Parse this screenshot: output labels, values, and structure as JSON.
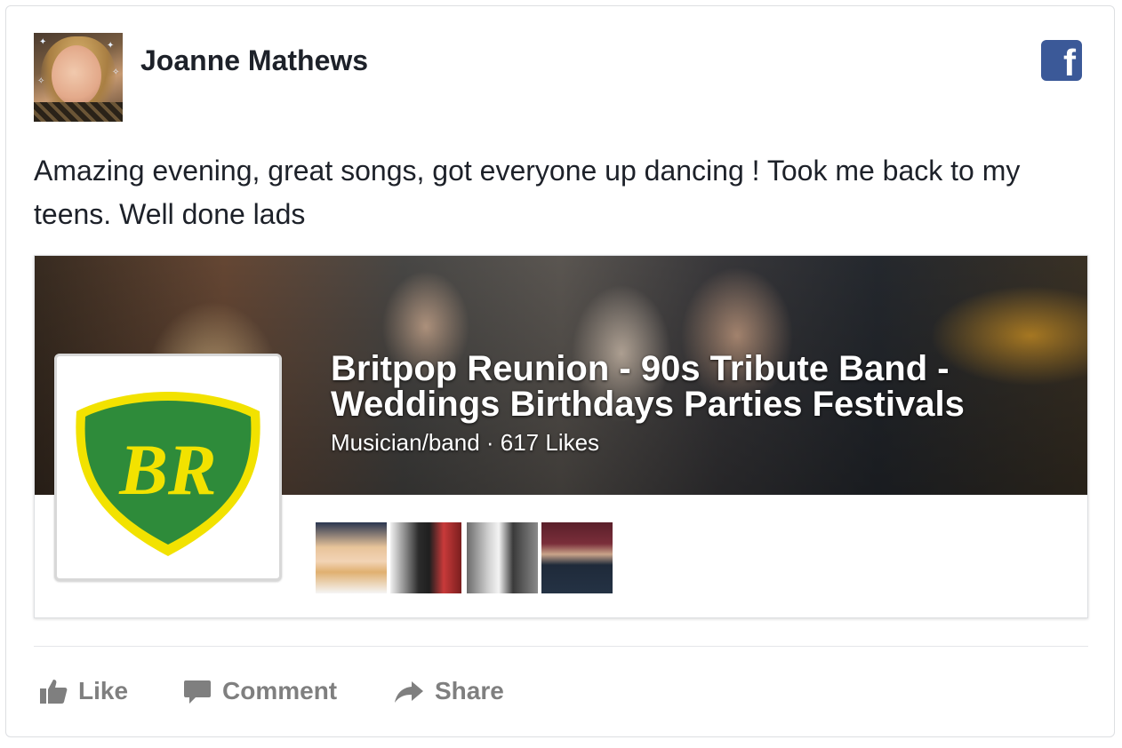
{
  "post": {
    "author": "Joanne Mathews",
    "text": "Amazing evening, great songs, got everyone up dancing ! Took me back to my teens. Well done lads"
  },
  "brand": {
    "logo_letter": "f",
    "logo_color": "#3b5998"
  },
  "page_card": {
    "title": "Britpop Reunion - 90s Tribute Band - Weddings Birthdays Parties Festivals",
    "meta": "Musician/band · 617 Likes",
    "logo_text": "BR",
    "logo_colors": {
      "shield_green": "#2e8b3a",
      "shield_yellow": "#f2e200"
    }
  },
  "actions": {
    "like": "Like",
    "comment": "Comment",
    "share": "Share"
  }
}
